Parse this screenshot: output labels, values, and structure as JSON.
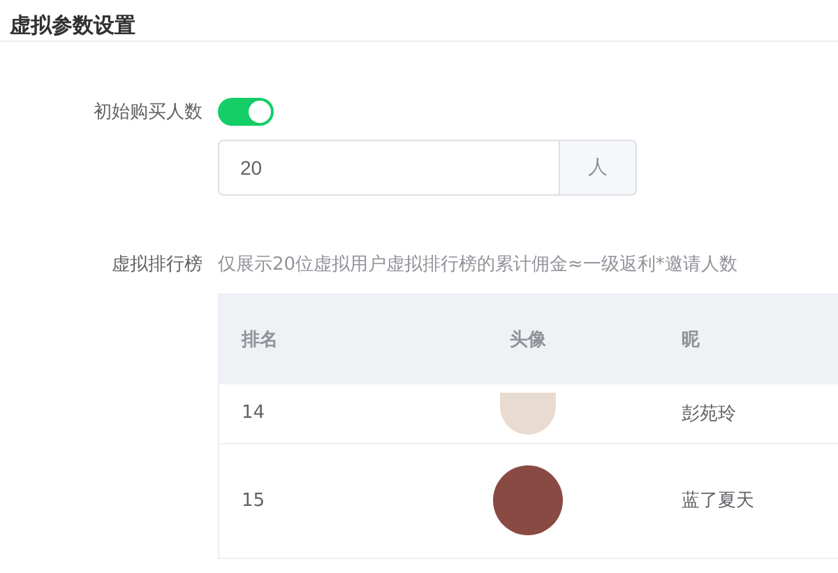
{
  "title": "虚拟参数设置",
  "initial_buyers": {
    "label": "初始购买人数",
    "on": true,
    "value": "20",
    "unit": "人"
  },
  "ranking": {
    "label": "虚拟排行榜",
    "description": "仅展示20位虚拟用户虚拟排行榜的累计佣金≈一级返利*邀请人数",
    "columns": [
      "排名",
      "头像",
      "昵"
    ],
    "rows": [
      {
        "rank": "14",
        "nickname": "彭苑玲"
      },
      {
        "rank": "15",
        "nickname": "蓝了夏天"
      }
    ]
  }
}
